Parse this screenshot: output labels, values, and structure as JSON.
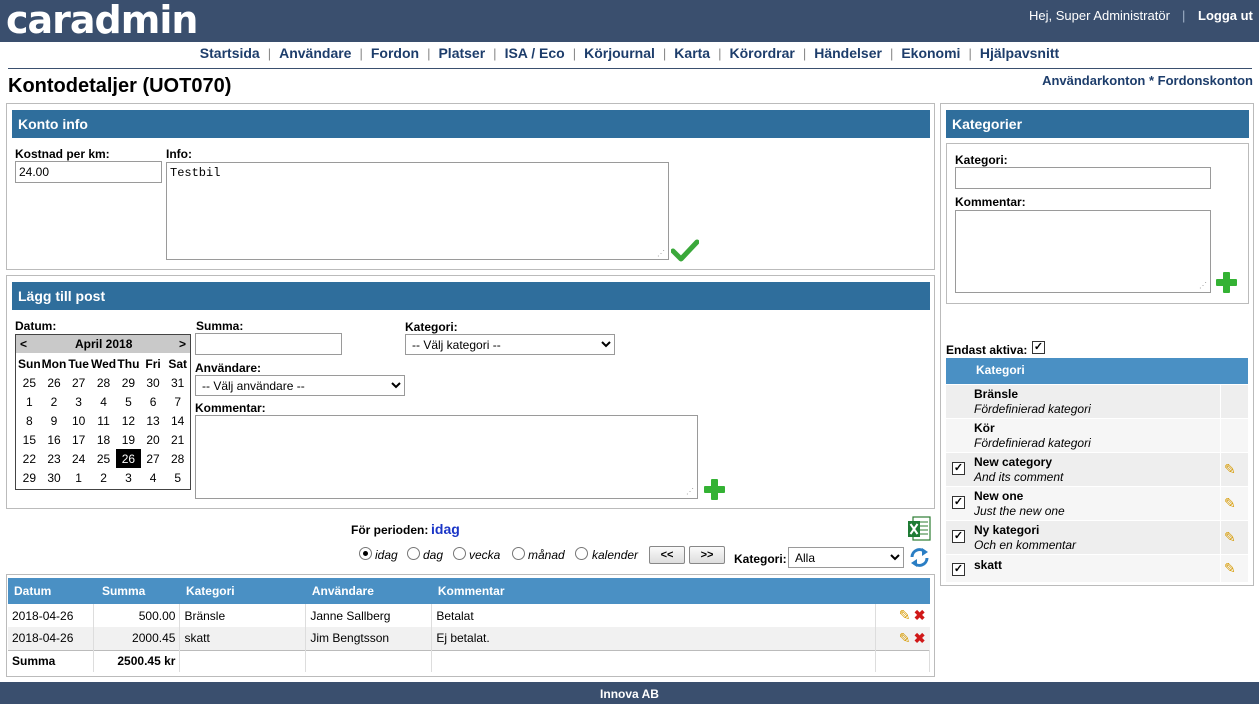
{
  "header": {
    "logo": "caradmin",
    "greeting": "Hej, Super Administratör",
    "separator": "|",
    "logout": "Logga ut"
  },
  "nav": {
    "items": [
      "Startsida",
      "Användare",
      "Fordon",
      "Platser",
      "ISA / Eco",
      "Körjournal",
      "Karta",
      "Körordrar",
      "Händelser",
      "Ekonomi",
      "Hjälpavsnitt"
    ],
    "separator": "|"
  },
  "page": {
    "title": "Kontodetaljer (UOT070)",
    "links": {
      "users": "Användarkonton",
      "sep": " * ",
      "vehicles": "Fordonskonton"
    }
  },
  "konto_info": {
    "heading": "Konto info",
    "cost_label": "Kostnad per km:",
    "cost_value": "24.00",
    "info_label": "Info:",
    "info_value": "Testbil"
  },
  "add_post": {
    "heading": "Lägg till post",
    "date_label": "Datum:",
    "sum_label": "Summa:",
    "user_label": "Användare:",
    "user_select": "-- Välj användare --",
    "category_label": "Kategori:",
    "category_select": "-- Välj kategori --",
    "comment_label": "Kommentar:"
  },
  "calendar": {
    "prev": "<",
    "next": ">",
    "month": "April 2018",
    "weekdays": [
      "Sun",
      "Mon",
      "Tue",
      "Wed",
      "Thu",
      "Fri",
      "Sat"
    ],
    "weeks": [
      [
        "25",
        "26",
        "27",
        "28",
        "29",
        "30",
        "31"
      ],
      [
        "1",
        "2",
        "3",
        "4",
        "5",
        "6",
        "7"
      ],
      [
        "8",
        "9",
        "10",
        "11",
        "12",
        "13",
        "14"
      ],
      [
        "15",
        "16",
        "17",
        "18",
        "19",
        "20",
        "21"
      ],
      [
        "22",
        "23",
        "24",
        "25",
        "26",
        "27",
        "28"
      ],
      [
        "29",
        "30",
        "1",
        "2",
        "3",
        "4",
        "5"
      ]
    ],
    "selected": "26"
  },
  "period": {
    "label": "För perioden:",
    "value": "idag",
    "options": [
      "idag",
      "dag",
      "vecka",
      "månad",
      "kalender"
    ],
    "selected": "idag",
    "prev_btn": "<<",
    "next_btn": ">>",
    "category_label": "Kategori:",
    "category_value": "Alla"
  },
  "entries": {
    "columns": [
      "Datum",
      "Summa",
      "Kategori",
      "Användare",
      "Kommentar"
    ],
    "rows": [
      {
        "date": "2018-04-26",
        "sum": "500.00",
        "category": "Bränsle",
        "user": "Janne Sallberg",
        "comment": "Betalat"
      },
      {
        "date": "2018-04-26",
        "sum": "2000.45",
        "category": "skatt",
        "user": "Jim Bengtsson",
        "comment": "Ej betalat."
      }
    ],
    "total_label": "Summa",
    "total_value": "2500.45 kr"
  },
  "categories_panel": {
    "heading": "Kategorier",
    "category_label": "Kategori:",
    "comment_label": "Kommentar:",
    "only_active_label": "Endast aktiva:",
    "list_header": "Kategori",
    "items": [
      {
        "name": "Bränsle",
        "comment": "Fördefinierad kategori",
        "checkbox": false,
        "editable": false
      },
      {
        "name": "Kör",
        "comment": "Fördefinierad kategori",
        "checkbox": false,
        "editable": false
      },
      {
        "name": "New category",
        "comment": "And its comment",
        "checkbox": true,
        "editable": true
      },
      {
        "name": "New one",
        "comment": "Just the new one",
        "checkbox": true,
        "editable": true
      },
      {
        "name": "Ny kategori",
        "comment": "Och en kommentar",
        "checkbox": true,
        "editable": true
      },
      {
        "name": "skatt",
        "comment": "",
        "checkbox": true,
        "editable": true
      }
    ]
  },
  "footer": {
    "text": "Innova AB"
  },
  "colors": {
    "header_bg": "#3a4f6e",
    "panel_head": "#2f6e9c",
    "table_head": "#4a90c4",
    "accent_green": "#34b234"
  },
  "icons": [
    "check-icon",
    "plus-icon",
    "excel-icon",
    "refresh-icon",
    "pencil-icon",
    "delete-icon"
  ]
}
